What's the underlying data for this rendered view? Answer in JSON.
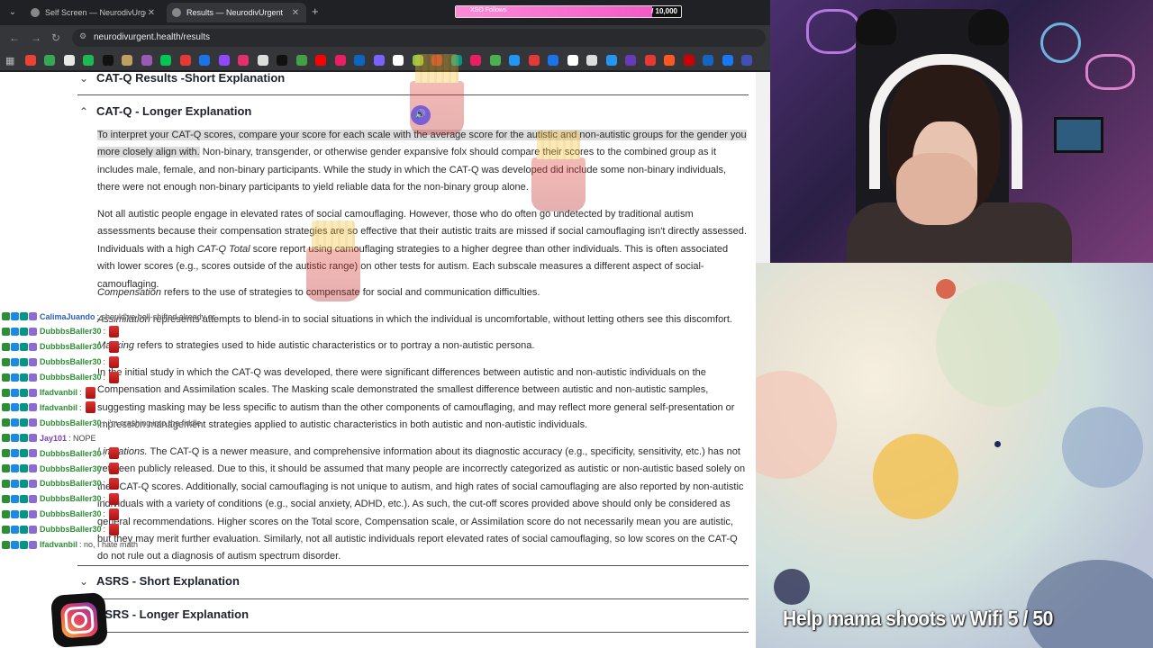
{
  "browser": {
    "tabs": [
      {
        "title": "Self Screen — NeurodivUrgent",
        "active": false
      },
      {
        "title": "Results — NeurodivUrgent",
        "active": true
      }
    ],
    "new_tab": "+",
    "url": "neurodivurgent.health/results",
    "bookmark_colors": [
      "#ea4335",
      "#34a853",
      "#e8e8e8",
      "#1db954",
      "#111111",
      "#c0a060",
      "#9b59b6",
      "#00c853",
      "#e53935",
      "#1a73e8",
      "#9146ff",
      "#e1306c",
      "#dddddd",
      "#111111",
      "#43a047",
      "#ff0000",
      "#e91e63",
      "#0a66c2",
      "#7b61ff",
      "#ffffff",
      "#8bc34a",
      "#b33",
      "#009688",
      "#e91e63",
      "#4caf50",
      "#2196f3",
      "#e53935",
      "#1a73e8",
      "#ffffff",
      "#dddddd",
      "#2196f3",
      "#673ab7",
      "#e53935",
      "#ff5722",
      "#cc0000",
      "#1565c0",
      "#1877f2",
      "#3f51b5"
    ]
  },
  "overlay": {
    "follow_goal_label": "XSO Follows",
    "follow_goal_count": "/ 10,000",
    "follow_goal_fraction": 0.87,
    "caption": "Help mama shoots w Wifi  5 / 50"
  },
  "sections": {
    "short_label": "CAT-Q Results -Short Explanation",
    "long_label": "CAT-Q - Longer Explanation",
    "asrs_short_label": "ASRS - Short Explanation",
    "asrs_long_label": "ASRS - Longer Explanation"
  },
  "paragraphs": {
    "p1_highlight": "To interpret your CAT-Q scores, compare your score for each scale with the average score for the autistic and non-autistic groups for the gender you more closely align with.",
    "p1_rest": " Non-binary, transgender, or otherwise gender expansive folx should compare their scores to the combined group as it includes male, female, and non-binary participants. While the study in which the CAT-Q was developed did include some non-binary individuals, there were not enough non-binary participants to yield reliable data for the non-binary group alone.",
    "p2_a": "Not all autistic people engage in elevated rates of social camouflaging. However, those who do often go undetected by traditional autism assessments because their compensation strategies are so effective that their autistic traits are missed if social camouflaging isn't directly assessed. Individuals with a high ",
    "p2_em": "CAT-Q Total",
    "p2_b": " score report using camouflaging strategies to a higher degree than other individuals. This is often associated with lower scores (e.g., scores outside of the autistic range) on other tests for autism. Each subscale measures a different aspect of social-camouflaging.",
    "p3_em": "Compensation",
    "p3": " refers to the use of strategies to compensate for social and communication difficulties.",
    "p4_em": "Assimilation",
    "p4": " represents attempts to blend-in to social situations in which the individual is uncomfortable, without letting others see this discomfort.",
    "p5_em": "Masking",
    "p5": " refers to strategies used to hide autistic characteristics or to portray a non-autistic persona.",
    "p6": "In the initial study in which the CAT-Q was developed, there were significant differences between autistic and non-autistic individuals on the Compensation and Assimilation scales. The Masking scale demonstrated the smallest difference between autistic and non-autistic samples, suggesting masking may be less specific to autism than the other components of camouflaging, and may reflect more general self-presentation or impression management strategies applied to autistic characteristics in both autistic and non-autistic individuals.",
    "p7_em": "Limitations.",
    "p7": " The CAT-Q is a newer measure, and comprehensive information about its diagnostic accuracy (e.g., specificity, sensitivity, etc.) has not yet been publicly released. Due to this, it should be assumed that many people are incorrectly categorized as autistic or non-autistic based solely on their CAT-Q scores. Additionally, social camouflaging is not unique to autism, and high rates of social camouflaging are also reported by non-autistic individuals with a variety of conditions (e.g., social anxiety, ADHD, etc.). As such, the cut-off scores provided above should only be considered as general recommendations. Higher scores on the Total score, Compensation scale, or Assimilation score do not necessarily mean you are autistic, but they may merit further evaluation. Similarly, not all autistic individuals report elevated rates of social camouflaging, so low scores on the CAT-Q do not rule out a diagnosis of autism spectrum disorder."
  },
  "chat": [
    {
      "name": "CalimaJuando",
      "color": "blue",
      "msg": ": should've hell-shifted already or"
    },
    {
      "name": "DubbbsBaller30",
      "color": "green",
      "msg": ":"
    },
    {
      "name": "DubbbsBaller30",
      "color": "green",
      "msg": ":"
    },
    {
      "name": "DubbbsBaller30",
      "color": "green",
      "msg": ":"
    },
    {
      "name": "DubbbsBaller30",
      "color": "green",
      "msg": ":"
    },
    {
      "name": "Ifadvanbil",
      "color": "green",
      "msg": ":"
    },
    {
      "name": "Ifadvanbil",
      "color": "green",
      "msg": ":"
    },
    {
      "name": "DubbbsBaller30",
      "color": "green",
      "msg": ": i'm crashing into the fiddle"
    },
    {
      "name": "Jay101",
      "color": "purple",
      "msg": ":       NOPE"
    },
    {
      "name": "DubbbsBaller30",
      "color": "green",
      "msg": ":"
    },
    {
      "name": "DubbbsBaller30",
      "color": "green",
      "msg": ":"
    },
    {
      "name": "DubbbsBaller30",
      "color": "green",
      "msg": ":"
    },
    {
      "name": "DubbbsBaller30",
      "color": "green",
      "msg": ":"
    },
    {
      "name": "DubbbsBaller30",
      "color": "green",
      "msg": ":"
    },
    {
      "name": "DubbbsBaller30",
      "color": "green",
      "msg": ":"
    },
    {
      "name": "Ifadvanbil",
      "color": "green",
      "msg": ": no, I hate math"
    }
  ]
}
